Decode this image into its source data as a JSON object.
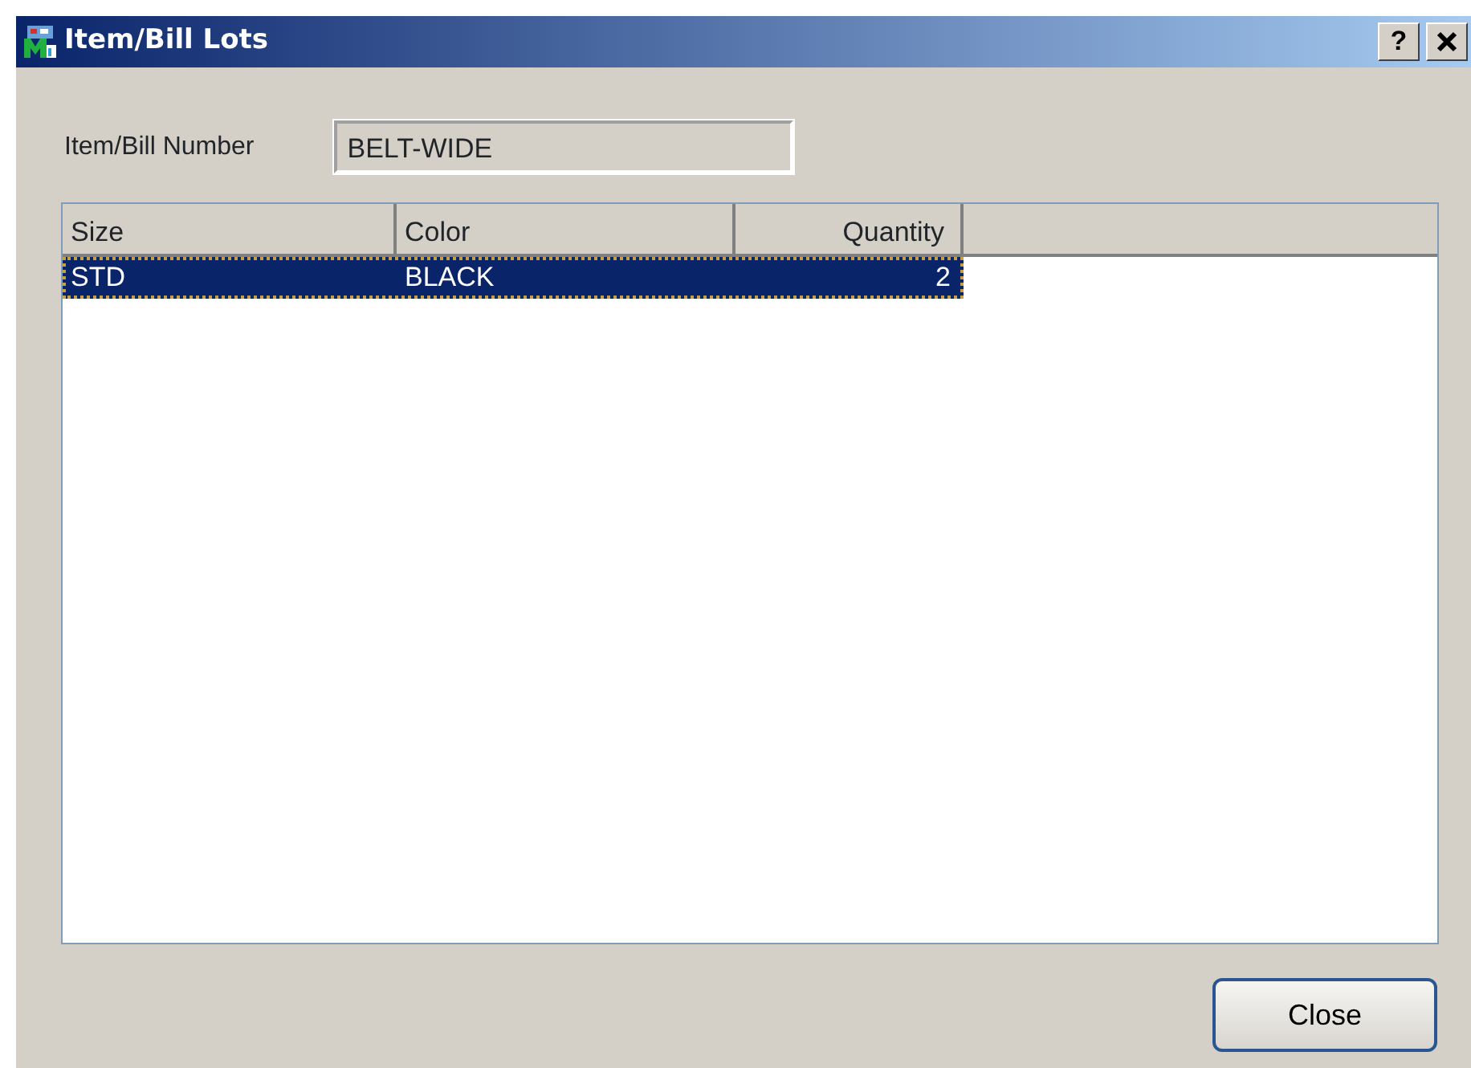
{
  "window": {
    "title": "Item/Bill Lots",
    "help_button": "?"
  },
  "item_number": {
    "label": "Item/Bill Number",
    "value": "BELT-WIDE"
  },
  "table": {
    "columns": [
      {
        "label": "Size",
        "kind": "text"
      },
      {
        "label": "Color",
        "kind": "text"
      },
      {
        "label": "Quantity",
        "kind": "number"
      }
    ],
    "rows": [
      {
        "cells": [
          "STD",
          "BLACK",
          "2"
        ],
        "selected": true
      }
    ]
  },
  "buttons": [
    {
      "label": "Close"
    }
  ]
}
